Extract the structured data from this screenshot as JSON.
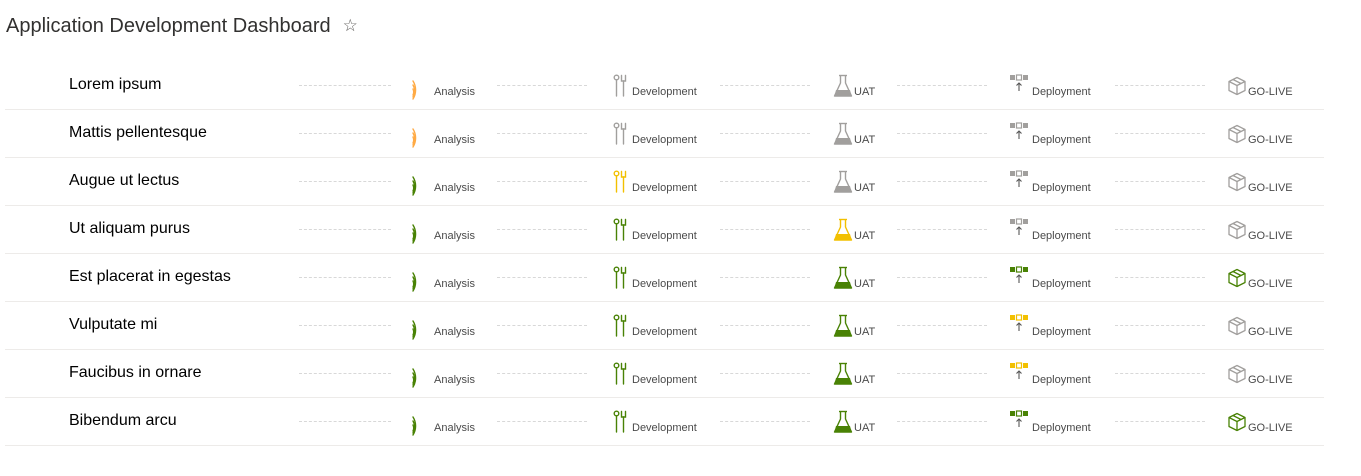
{
  "page": {
    "title": "Application Development Dashboard",
    "star_icon": "star-icon"
  },
  "stage_labels": {
    "analysis": "Analysis",
    "development": "Development",
    "uat": "UAT",
    "deployment": "Deployment",
    "golive": "GO-LIVE"
  },
  "colors": {
    "done": "#498205",
    "in_progress_analysis": "#ffaa44",
    "in_progress": "#f2c000",
    "pending": "#a19f9d"
  },
  "rows": [
    {
      "name": "Lorem ipsum",
      "status": [
        "in-progress",
        "pending",
        "pending",
        "pending",
        "pending"
      ]
    },
    {
      "name": "Mattis pellentesque",
      "status": [
        "in-progress",
        "pending",
        "pending",
        "pending",
        "pending"
      ]
    },
    {
      "name": "Augue ut lectus",
      "status": [
        "done",
        "in-progress",
        "pending",
        "pending",
        "pending"
      ]
    },
    {
      "name": "Ut aliquam purus",
      "status": [
        "done",
        "done",
        "in-progress",
        "pending",
        "pending"
      ]
    },
    {
      "name": "Est placerat in egestas",
      "status": [
        "done",
        "done",
        "done",
        "done",
        "done"
      ]
    },
    {
      "name": "Vulputate mi",
      "status": [
        "done",
        "done",
        "done",
        "in-progress",
        "pending"
      ]
    },
    {
      "name": "Faucibus in ornare",
      "status": [
        "done",
        "done",
        "done",
        "in-progress",
        "pending"
      ]
    },
    {
      "name": "Bibendum arcu",
      "status": [
        "done",
        "done",
        "done",
        "done",
        "done"
      ]
    }
  ]
}
